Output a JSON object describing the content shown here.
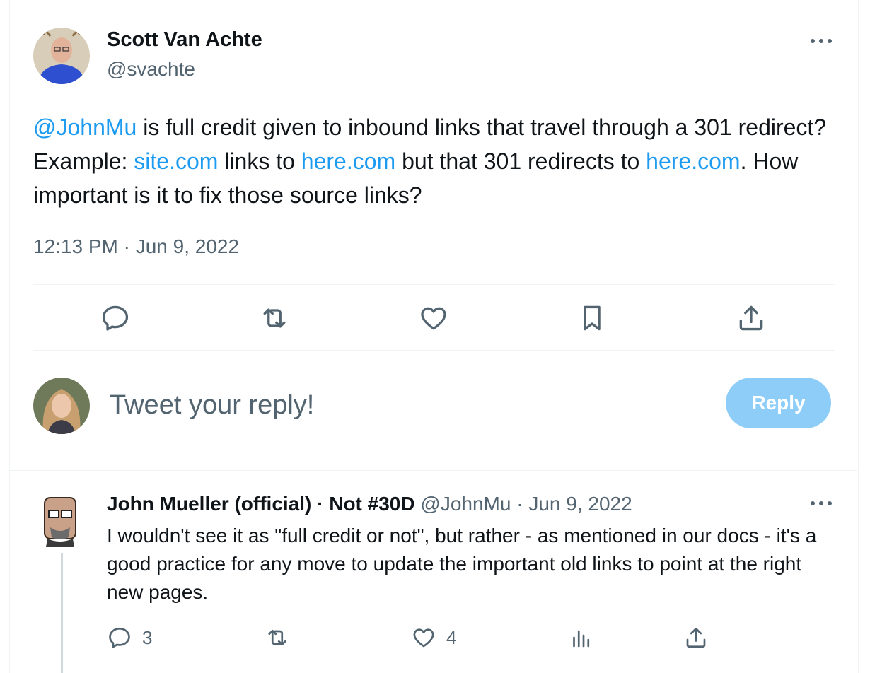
{
  "tweet": {
    "author_name": "Scott Van Achte",
    "author_handle": "@svachte",
    "text_parts": {
      "mention": "@JohnMu",
      "t1": " is full credit given to inbound links that travel through a 301 redirect?   Example: ",
      "link1": "site.com",
      "t2": " links to ",
      "link2": "here.com",
      "t3": " but that 301 redirects to ",
      "link3": "here.com",
      "t4": ". How important is it to fix those source links?"
    },
    "timestamp": "12:13 PM · Jun 9, 2022"
  },
  "actions": {
    "icons": [
      "reply-icon",
      "retweet-icon",
      "like-icon",
      "bookmark-icon",
      "share-icon"
    ]
  },
  "compose": {
    "placeholder": "Tweet your reply!",
    "reply_label": "Reply"
  },
  "reply": {
    "author_name": "John Mueller (official) · Not #30D",
    "author_handle": "@JohnMu",
    "date": " · Jun 9, 2022",
    "text": "I wouldn't see it as \"full credit or not\", but rather - as mentioned in our docs - it's a good practice for any move to update the important old links to point at the right new pages.",
    "reply_count": "3",
    "like_count": "4"
  },
  "colors": {
    "accent": "#1d9bf0",
    "secondary_text": "#536471",
    "reply_button_disabled": "#8ecdf8"
  }
}
